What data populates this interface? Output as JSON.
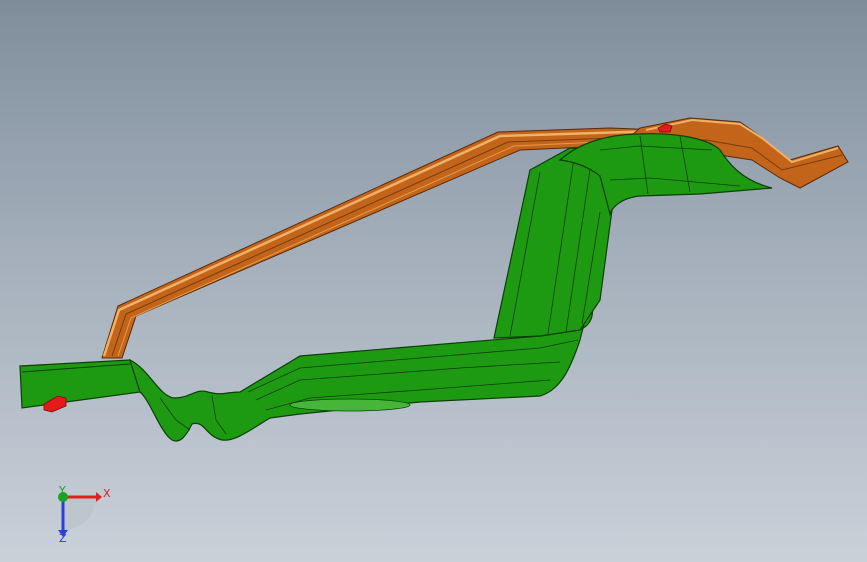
{
  "viewport": {
    "background_top": "#7f8d9b",
    "background_bottom": "#c9d1d9"
  },
  "model": {
    "green_part_color": "#1e9a12",
    "green_part_edge": "#0b3f06",
    "orange_part_color": "#c2651a",
    "orange_part_highlight": "#f1b068",
    "marker_color": "#e41b1b"
  },
  "triad": {
    "x_label": "X",
    "y_label": "Y",
    "z_label": "Z",
    "x_color": "#e0201c",
    "y_color": "#1fa31f",
    "z_color": "#2a3fd6"
  }
}
